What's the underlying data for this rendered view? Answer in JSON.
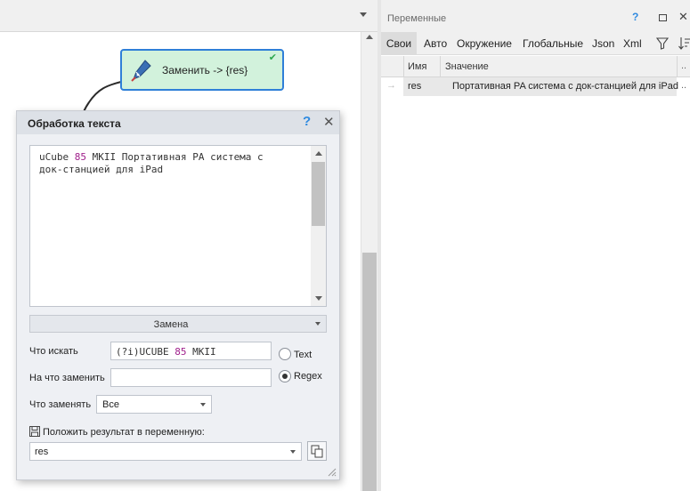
{
  "node": {
    "label": "Заменить -> {res}",
    "check": "✔"
  },
  "dialog": {
    "title": "Обработка текста",
    "help": "?",
    "close": "✕",
    "text_area": {
      "line1_a": "uCube ",
      "line1_num": "85",
      "line1_b": " MKII Портативная PA система с",
      "line2": "док-станцией для iPad"
    },
    "mode": "Замена",
    "find_label": "Что искать",
    "find_prefix": "(?i)UCUBE ",
    "find_num": "85",
    "find_suffix": " MKII",
    "replace_label": "На что заменить",
    "replace_value": "",
    "radio_text": "Text",
    "radio_regex": "Regex",
    "what_label": "Что заменять",
    "what_value": "Все",
    "result_label": "Положить результат в переменную:",
    "result_value": "res"
  },
  "variables": {
    "title": "Переменные",
    "help": "?",
    "close": "✕",
    "tabs": [
      "Свои",
      "Авто",
      "Окружение",
      "Глобальные",
      "Json",
      "Xml"
    ],
    "columns": {
      "name": "Имя",
      "value": "Значение",
      "more": ".."
    },
    "rows": [
      {
        "arrow": "→",
        "name": "res",
        "value": "Портативная PA система с док-станцией для iPad",
        "more": ".."
      }
    ]
  }
}
